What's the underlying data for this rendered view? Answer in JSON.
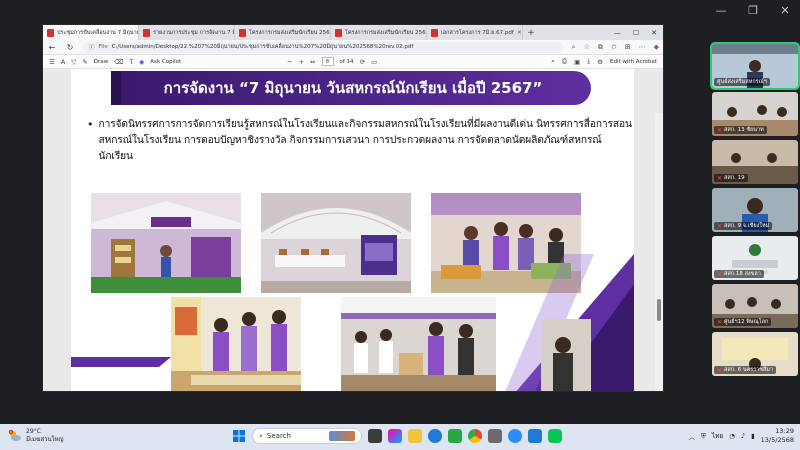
{
  "browser": {
    "tabs": [
      {
        "label": "ประชุมการขับเคลื่อนงาน 7 มิถุนายน 25",
        "active": true
      },
      {
        "label": "รายงานการประชุม การจัดงาน 7 มิถุนายน",
        "active": false
      },
      {
        "label": "โครงการกรมส่งเสริมนักเรียน 2568 สหกรณ์",
        "active": false
      },
      {
        "label": "โครงการกรมส่งเสริมนักเรียน 2568 สหกรณ์",
        "active": false
      },
      {
        "label": "เอกสารโครงการ 7มิ.ย.67.pdf",
        "active": false
      }
    ],
    "file_label": "File",
    "url": "C:/Users/admin/Desktop/22.%207%20มิถุนายน/ประชุมการขับเคลื่อนงาน%207%20มิถุนายน%202568%20rev.02.pdf"
  },
  "pdf_toolbar": {
    "draw_label": "Draw",
    "copilot_label": "Ask Copilot",
    "page_current": "8",
    "page_total": "of 14",
    "edit_acrobat_label": "Edit with Acrobat"
  },
  "slide": {
    "title": "การจัดงาน “7 มิถุนายน วันสหกรณ์นักเรียน เมื่อปี 2567”",
    "bullet": "การจัดนิทรรศการการจัดการเรียนรู้สหกรณ์ในโรงเรียนและกิจกรรมสหกรณ์ในโรงเรียนที่มีผลงานดีเด่น นิทรรศการสื่อการสอนสหกรณ์ในโรงเรียน การตอบปัญหาชิงรางวัล กิจกรรมการเสวนา การประกวดผลงาน การจัดตลาดนัดผลิตภัณฑ์สหกรณ์นักเรียน"
  },
  "participants": [
    {
      "label": "ศูนย์ส่งเสริมสหกรณ์ฯ",
      "mic_off": false,
      "speaking": true
    },
    {
      "label": "สสก. 13 ชัยนาท",
      "mic_off": true,
      "speaking": false
    },
    {
      "label": "สสก. 19",
      "mic_off": true,
      "speaking": false
    },
    {
      "label": "สสก. 9 จ.เชียงใหม่",
      "mic_off": true,
      "speaking": false
    },
    {
      "label": "สสก.18 สงขลา",
      "mic_off": true,
      "speaking": false
    },
    {
      "label": "ศูนย์ฯ12 พิษณุโลก",
      "mic_off": true,
      "speaking": false
    },
    {
      "label": "สสก. 6 นครราชสีมา",
      "mic_off": true,
      "speaking": false
    }
  ],
  "taskbar": {
    "weather_temp": "29°C",
    "weather_desc": "มีเมฆส่วนใหญ่",
    "search_placeholder": "Search",
    "lang": "ไทย",
    "time": "13:29",
    "date": "13/5/2568",
    "weather_badge": "1"
  },
  "colors": {
    "slide_purple": "#5e2fa0",
    "slide_dark_purple": "#3b1a6e",
    "speaking_outline": "#2ecc71"
  }
}
